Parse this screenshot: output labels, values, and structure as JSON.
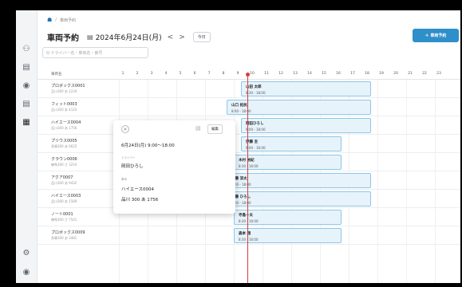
{
  "breadcrumb": {
    "current": "車両予約"
  },
  "header": {
    "title": "車両予約",
    "date": "2024年6月24日(月)",
    "prev": "<",
    "next": ">",
    "today": "今日",
    "new_button": "＋ 車両予約"
  },
  "search": {
    "placeholder": "Q  ドライバー名・車両名・番号"
  },
  "grid": {
    "column_label": "車両名",
    "hours": [
      "1",
      "2",
      "3",
      "4",
      "5",
      "6",
      "7",
      "8",
      "9",
      "10",
      "11",
      "12",
      "13",
      "14",
      "15",
      "16",
      "17",
      "18",
      "19",
      "20",
      "21",
      "22",
      "23"
    ]
  },
  "vehicles": [
    {
      "name": "プロボックス0001",
      "plate": "品川300 あ 1234"
    },
    {
      "name": "フィット0003",
      "plate": "品川300 あ 4123"
    },
    {
      "name": "ハイエース0004",
      "plate": "品川300 あ 1756"
    },
    {
      "name": "プリウス0005",
      "plate": "多摩300 あ 6625"
    },
    {
      "name": "クラウン0006",
      "plate": "練馬300 さ 3210"
    },
    {
      "name": "アクア0007",
      "plate": "品川300 あ 9432"
    },
    {
      "name": "ハイエース0003",
      "plate": "品川300 あ 1589"
    },
    {
      "name": "ノート0001",
      "plate": "練馬300 さ 7541"
    },
    {
      "name": "プロボックス0009",
      "plate": "多摩300 あ 3481"
    }
  ],
  "reservations": [
    {
      "name": "山田 太郎",
      "time": "8:30 - 18:00"
    },
    {
      "name": "山口 拓抗",
      "time": "8:00 - 18:00"
    },
    {
      "name": "岡田ひろし",
      "time": "9:00 - 18:00"
    },
    {
      "name": "伊藤 圭",
      "time": "9:00 - 16:00"
    },
    {
      "name": "木村 裕紀",
      "time": "8:30 - 16:00"
    },
    {
      "name": "佐藤 涼太",
      "time": "8:00 - 18:00"
    },
    {
      "name": "佐藤 ひろし",
      "time": "8:00 - 18:00"
    },
    {
      "name": "寺島一夫",
      "time": "8:30 - 16:00"
    },
    {
      "name": "森本 翔",
      "time": "8:30 - 16:00"
    }
  ],
  "popup": {
    "datetime": "6月24日(月) 9:00〜18:00",
    "driver_label": "ドライバー",
    "driver": "岡田ひろし",
    "vehicle_label": "車両",
    "vehicle_name": "ハイエース0004",
    "vehicle_plate": "品川 300 あ 1756",
    "edit": "編集"
  },
  "colors": {
    "accent": "#2e8fc9",
    "now_line": "#d93b3b",
    "reservation_fill": "#e6f3fb"
  }
}
